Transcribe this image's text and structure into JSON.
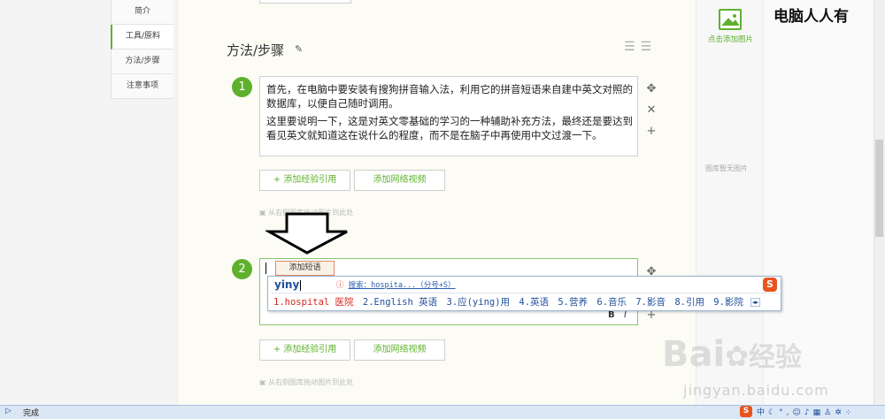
{
  "nav": {
    "items": [
      "简介",
      "工具/原料",
      "方法/步骤",
      "注意事项"
    ],
    "active_index": 1
  },
  "section": {
    "title": "方法/步骤"
  },
  "step1": {
    "number": "1",
    "para1": "首先，在电脑中要安装有搜狗拼音输入法，利用它的拼音短语来自建中英文对照的数据库，以便自己随时调用。",
    "para2": "这里要说明一下，这是对英文零基础的学习的一种辅助补充方法，最终还是要达到看见英文就知道这在说什么的程度，而不是在脑子中再使用中文过渡一下。"
  },
  "step2": {
    "number": "2"
  },
  "buttons": {
    "add_ref": "+ 添加经验引用",
    "add_video": "添加网络视频"
  },
  "drop_tip": "从右侧图库拖动图片到此处",
  "ime": {
    "add_phrase": "添加短语",
    "code": "yiny",
    "search_hint": "搜索：hospita...（分号+S）",
    "candidates": [
      {
        "num": "1.",
        "text": "hospital 医院"
      },
      {
        "num": "2.",
        "text": "English 英语"
      },
      {
        "num": "3.",
        "text": "应(ying)用"
      },
      {
        "num": "4.",
        "text": "英语"
      },
      {
        "num": "5.",
        "text": "营养"
      },
      {
        "num": "6.",
        "text": "音乐"
      },
      {
        "num": "7.",
        "text": "影音"
      },
      {
        "num": "8.",
        "text": "引用"
      },
      {
        "num": "9.",
        "text": "影院"
      }
    ]
  },
  "gallery": {
    "add_image": "点击添加图片",
    "empty": "图库暂无图片"
  },
  "watermark": {
    "top": "电脑人人有",
    "baidu": "Bai",
    "baidu2": "经验",
    "url": "jingyan.baidu.com"
  },
  "status": {
    "text": "完成"
  },
  "colors": {
    "accent": "#5fb12d",
    "ime_blue": "#1e4f9c",
    "ime_red": "#d9261c"
  }
}
